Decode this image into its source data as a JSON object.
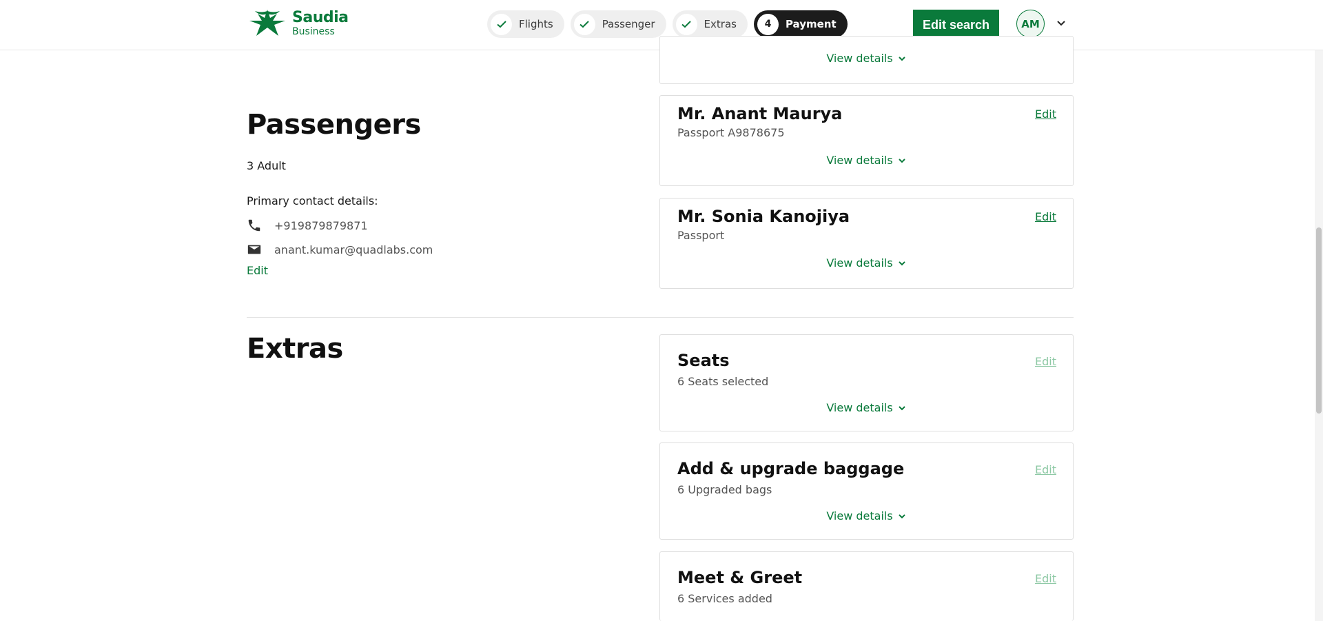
{
  "header": {
    "logo_line1": "Saudia",
    "logo_line2": "Business",
    "steps": [
      {
        "label": "Flights",
        "state": "done"
      },
      {
        "label": "Passenger",
        "state": "done"
      },
      {
        "label": "Extras",
        "state": "done"
      },
      {
        "label": "Payment",
        "number": "4",
        "state": "active"
      }
    ],
    "edit_search_label": "Edit search",
    "avatar_initials": "AM"
  },
  "passengers": {
    "title": "Passengers",
    "count": "3 Adult",
    "contact_heading": "Primary contact details:",
    "phone": "+919879879871",
    "email": "anant.kumar@quadlabs.com",
    "edit_label": "Edit",
    "cards": [
      {
        "view_details": "View details"
      },
      {
        "name": "Mr. Anant Maurya",
        "document": "Passport A9878675",
        "edit": "Edit",
        "view_details": "View details"
      },
      {
        "name": "Mr. Sonia Kanojiya",
        "document": "Passport",
        "edit": "Edit",
        "view_details": "View details"
      }
    ]
  },
  "extras": {
    "title": "Extras",
    "cards": [
      {
        "title": "Seats",
        "summary": "6 Seats selected",
        "edit": "Edit",
        "view_details": "View details"
      },
      {
        "title": "Add & upgrade baggage",
        "summary": "6 Upgraded bags",
        "edit": "Edit",
        "view_details": "View details"
      },
      {
        "title": "Meet & Greet",
        "summary": "6 Services added",
        "edit": "Edit"
      }
    ]
  },
  "colors": {
    "brand_green": "#0a7a3b",
    "active_step": "#1c1c1c"
  }
}
